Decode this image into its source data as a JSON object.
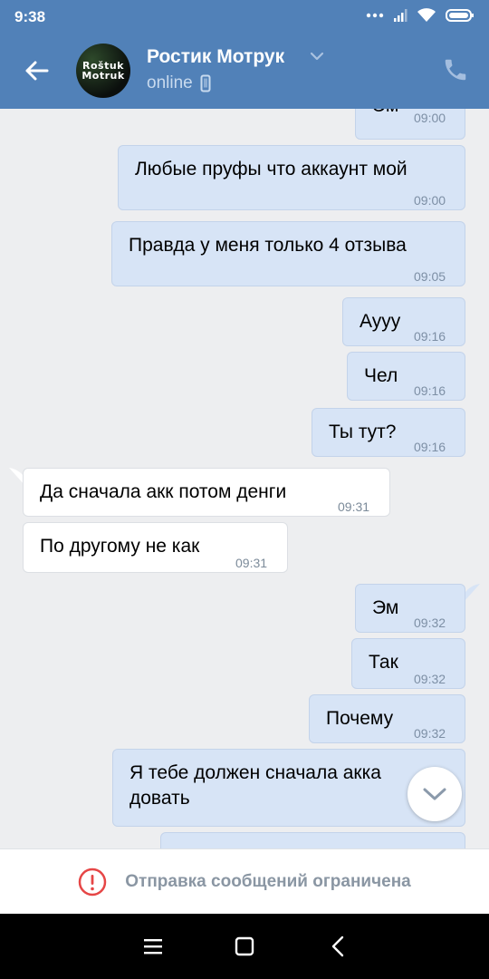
{
  "status_bar": {
    "time": "9:38"
  },
  "header": {
    "title": "Ростик Мотрук",
    "subtitle": "online",
    "avatar_text": [
      "Roštuk",
      "Motruk"
    ]
  },
  "messages": [
    {
      "dir": "out",
      "text": "Эм",
      "time": "09:00"
    },
    {
      "dir": "out",
      "text": "Любые пруфы что аккаунт мой",
      "time": "09:00"
    },
    {
      "dir": "out",
      "text": "Правда у меня только 4 отзыва",
      "time": "09:05"
    },
    {
      "dir": "out",
      "text": "Аууу",
      "time": "09:16"
    },
    {
      "dir": "out",
      "text": "Чел",
      "time": "09:16"
    },
    {
      "dir": "out",
      "text": "Ты тут?",
      "time": "09:16"
    },
    {
      "dir": "in",
      "text": "Да сначала акк потом денги",
      "time": "09:31"
    },
    {
      "dir": "in",
      "text": "По другому не как",
      "time": "09:31"
    },
    {
      "dir": "out",
      "text": "Эм",
      "time": "09:32"
    },
    {
      "dir": "out",
      "text": "Так",
      "time": "09:32"
    },
    {
      "dir": "out",
      "text": "Почему",
      "time": "09:32"
    },
    {
      "dir": "out",
      "text": "Я тебе должен сначала акка",
      "text2": "довать",
      "time": ""
    },
    {
      "dir": "out",
      "text": "",
      "time": ""
    }
  ],
  "footer": {
    "restricted_text": "Отправка сообщений ограничена"
  },
  "icons": {
    "back": "arrow-left-icon",
    "call": "phone-icon",
    "scroll": "chevron-down-icon",
    "warning": "exclamation-circle-icon"
  },
  "colors": {
    "header": "#5181b8",
    "out_bubble": "#d7e4f6",
    "in_bubble": "#ffffff",
    "warning": "#e64646"
  }
}
